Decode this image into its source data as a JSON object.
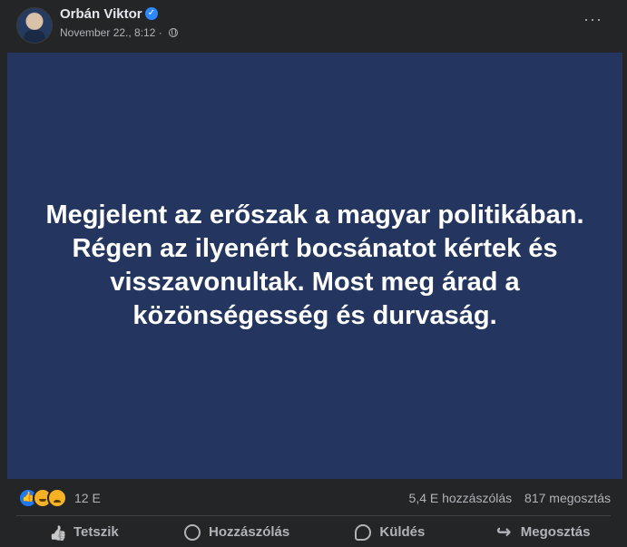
{
  "post": {
    "author": "Orbán Viktor",
    "date": "November 22., 8:12",
    "separator": "·",
    "verified_icon": "verified-badge-icon",
    "privacy_icon": "globe-icon",
    "more_label": "···",
    "text": "Megjelent az erőszak a magyar politikában. Régen az ilyenért bocsánatot kértek és visszavonultak. Most meg árad a közönségesség és durvaság."
  },
  "engagement": {
    "reaction_icons": [
      "like-icon",
      "haha-icon",
      "sad-icon"
    ],
    "reaction_count": "12 E",
    "comments": "5,4 E hozzászólás",
    "shares": "817 megosztás"
  },
  "actions": [
    {
      "label": "Tetszik",
      "icon": "like-outline-icon"
    },
    {
      "label": "Hozzászólás",
      "icon": "comment-icon"
    },
    {
      "label": "Küldés",
      "icon": "messenger-icon"
    },
    {
      "label": "Megosztás",
      "icon": "share-icon"
    }
  ],
  "colors": {
    "background": "#242526",
    "image_background": "#24365f",
    "text_primary": "#e4e6eb",
    "text_secondary": "#b0b3b8",
    "accent": "#2d88ff"
  }
}
